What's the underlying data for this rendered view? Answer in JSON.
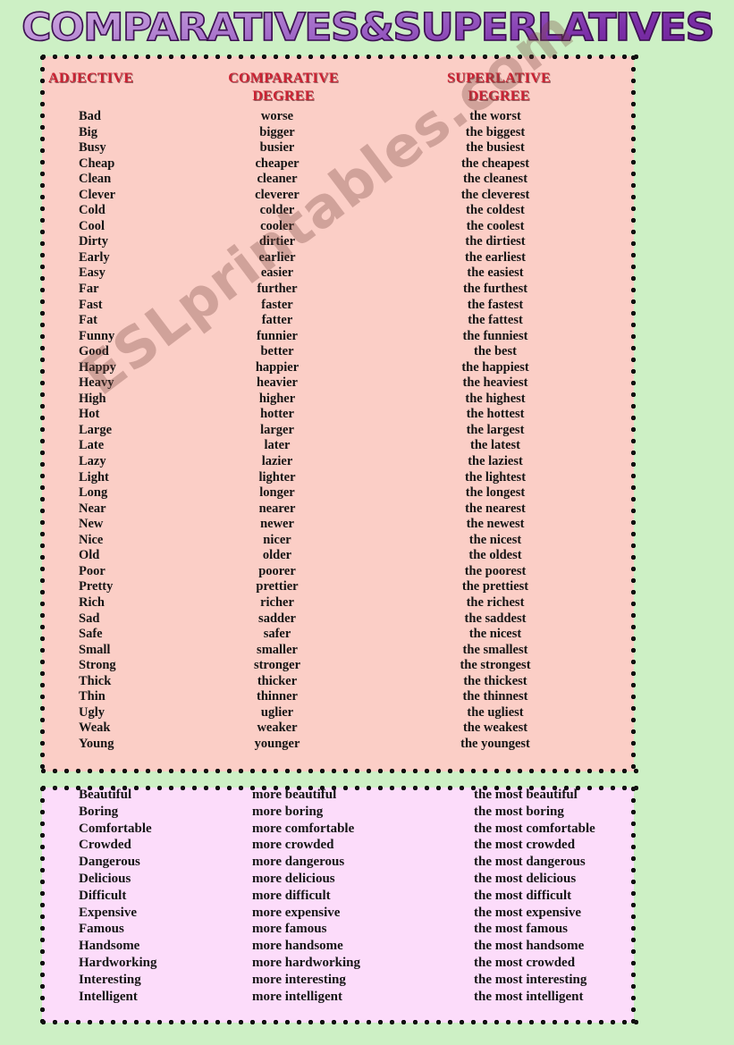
{
  "page": {
    "title": "COMPARATIVES&SUPERLATIVES",
    "watermark": "ESLprintables.com",
    "background_color": "#cdf0c5",
    "main_panel_color": "#fbcec6",
    "extra_panel_color": "#fcdcfa",
    "header_color": "#cc2233",
    "title_gradient_from": "#d3aee4",
    "title_gradient_to": "#6b2196"
  },
  "headers": {
    "adjective": "ADJECTIVE",
    "comparative_line1": "COMPARATIVE",
    "comparative_line2": "DEGREE",
    "superlative_line1": "SUPERLATIVE",
    "superlative_line2": "DEGREE"
  },
  "main_rows": [
    {
      "adjective": "Bad",
      "comparative": "worse",
      "superlative": "the worst"
    },
    {
      "adjective": "Big",
      "comparative": "bigger",
      "superlative": "the biggest"
    },
    {
      "adjective": "Busy",
      "comparative": "busier",
      "superlative": "the busiest"
    },
    {
      "adjective": "Cheap",
      "comparative": "cheaper",
      "superlative": "the cheapest"
    },
    {
      "adjective": "Clean",
      "comparative": "cleaner",
      "superlative": "the cleanest"
    },
    {
      "adjective": "Clever",
      "comparative": "cleverer",
      "superlative": "the cleverest"
    },
    {
      "adjective": "Cold",
      "comparative": "colder",
      "superlative": "the coldest"
    },
    {
      "adjective": "Cool",
      "comparative": "cooler",
      "superlative": "the coolest"
    },
    {
      "adjective": "Dirty",
      "comparative": "dirtier",
      "superlative": "the dirtiest"
    },
    {
      "adjective": "Early",
      "comparative": "earlier",
      "superlative": "the earliest"
    },
    {
      "adjective": "Easy",
      "comparative": "easier",
      "superlative": "the easiest"
    },
    {
      "adjective": "Far",
      "comparative": "further",
      "superlative": "the furthest"
    },
    {
      "adjective": "Fast",
      "comparative": "faster",
      "superlative": "the fastest"
    },
    {
      "adjective": "Fat",
      "comparative": "fatter",
      "superlative": "the fattest"
    },
    {
      "adjective": "Funny",
      "comparative": "funnier",
      "superlative": "the funniest"
    },
    {
      "adjective": "Good",
      "comparative": "better",
      "superlative": "the best"
    },
    {
      "adjective": "Happy",
      "comparative": "happier",
      "superlative": "the happiest"
    },
    {
      "adjective": "Heavy",
      "comparative": "heavier",
      "superlative": "the heaviest"
    },
    {
      "adjective": "High",
      "comparative": "higher",
      "superlative": "the highest"
    },
    {
      "adjective": "Hot",
      "comparative": "hotter",
      "superlative": "the hottest"
    },
    {
      "adjective": "Large",
      "comparative": "larger",
      "superlative": "the largest"
    },
    {
      "adjective": "Late",
      "comparative": "later",
      "superlative": "the latest"
    },
    {
      "adjective": "Lazy",
      "comparative": "lazier",
      "superlative": "the laziest"
    },
    {
      "adjective": "Light",
      "comparative": "lighter",
      "superlative": "the lightest"
    },
    {
      "adjective": "Long",
      "comparative": "longer",
      "superlative": "the longest"
    },
    {
      "adjective": "Near",
      "comparative": "nearer",
      "superlative": "the nearest"
    },
    {
      "adjective": "New",
      "comparative": "newer",
      "superlative": "the newest"
    },
    {
      "adjective": "Nice",
      "comparative": "nicer",
      "superlative": "the nicest"
    },
    {
      "adjective": "Old",
      "comparative": "older",
      "superlative": "the oldest"
    },
    {
      "adjective": "Poor",
      "comparative": "poorer",
      "superlative": "the poorest"
    },
    {
      "adjective": "Pretty",
      "comparative": "prettier",
      "superlative": "the prettiest"
    },
    {
      "adjective": "Rich",
      "comparative": "richer",
      "superlative": "the richest"
    },
    {
      "adjective": "Sad",
      "comparative": "sadder",
      "superlative": "the saddest"
    },
    {
      "adjective": "Safe",
      "comparative": "safer",
      "superlative": "the nicest"
    },
    {
      "adjective": "Small",
      "comparative": "smaller",
      "superlative": "the smallest"
    },
    {
      "adjective": "Strong",
      "comparative": "stronger",
      "superlative": "the strongest"
    },
    {
      "adjective": "Thick",
      "comparative": "thicker",
      "superlative": "the thickest"
    },
    {
      "adjective": "Thin",
      "comparative": "thinner",
      "superlative": "the thinnest"
    },
    {
      "adjective": "Ugly",
      "comparative": "uglier",
      "superlative": "the ugliest"
    },
    {
      "adjective": "Weak",
      "comparative": "weaker",
      "superlative": "the weakest"
    },
    {
      "adjective": "Young",
      "comparative": "younger",
      "superlative": "the youngest"
    }
  ],
  "extra_rows": [
    {
      "adjective": "Beautiful",
      "comparative": "more beautiful",
      "superlative": "the most beautiful"
    },
    {
      "adjective": "Boring",
      "comparative": "more boring",
      "superlative": "the most boring"
    },
    {
      "adjective": "Comfortable",
      "comparative": "more comfortable",
      "superlative": "the most comfortable"
    },
    {
      "adjective": "Crowded",
      "comparative": "more crowded",
      "superlative": "the most crowded"
    },
    {
      "adjective": "Dangerous",
      "comparative": "more dangerous",
      "superlative": "the most dangerous"
    },
    {
      "adjective": "Delicious",
      "comparative": "more delicious",
      "superlative": "the most delicious"
    },
    {
      "adjective": "Difficult",
      "comparative": "more difficult",
      "superlative": "the most difficult"
    },
    {
      "adjective": "Expensive",
      "comparative": "more expensive",
      "superlative": "the most expensive"
    },
    {
      "adjective": "Famous",
      "comparative": "more famous",
      "superlative": "the most famous"
    },
    {
      "adjective": "Handsome",
      "comparative": "more handsome",
      "superlative": "the most handsome"
    },
    {
      "adjective": "Hardworking",
      "comparative": "more hardworking",
      "superlative": "the most crowded"
    },
    {
      "adjective": "Interesting",
      "comparative": "more interesting",
      "superlative": "the most interesting"
    },
    {
      "adjective": "Intelligent",
      "comparative": "more intelligent",
      "superlative": "the most intelligent"
    }
  ]
}
